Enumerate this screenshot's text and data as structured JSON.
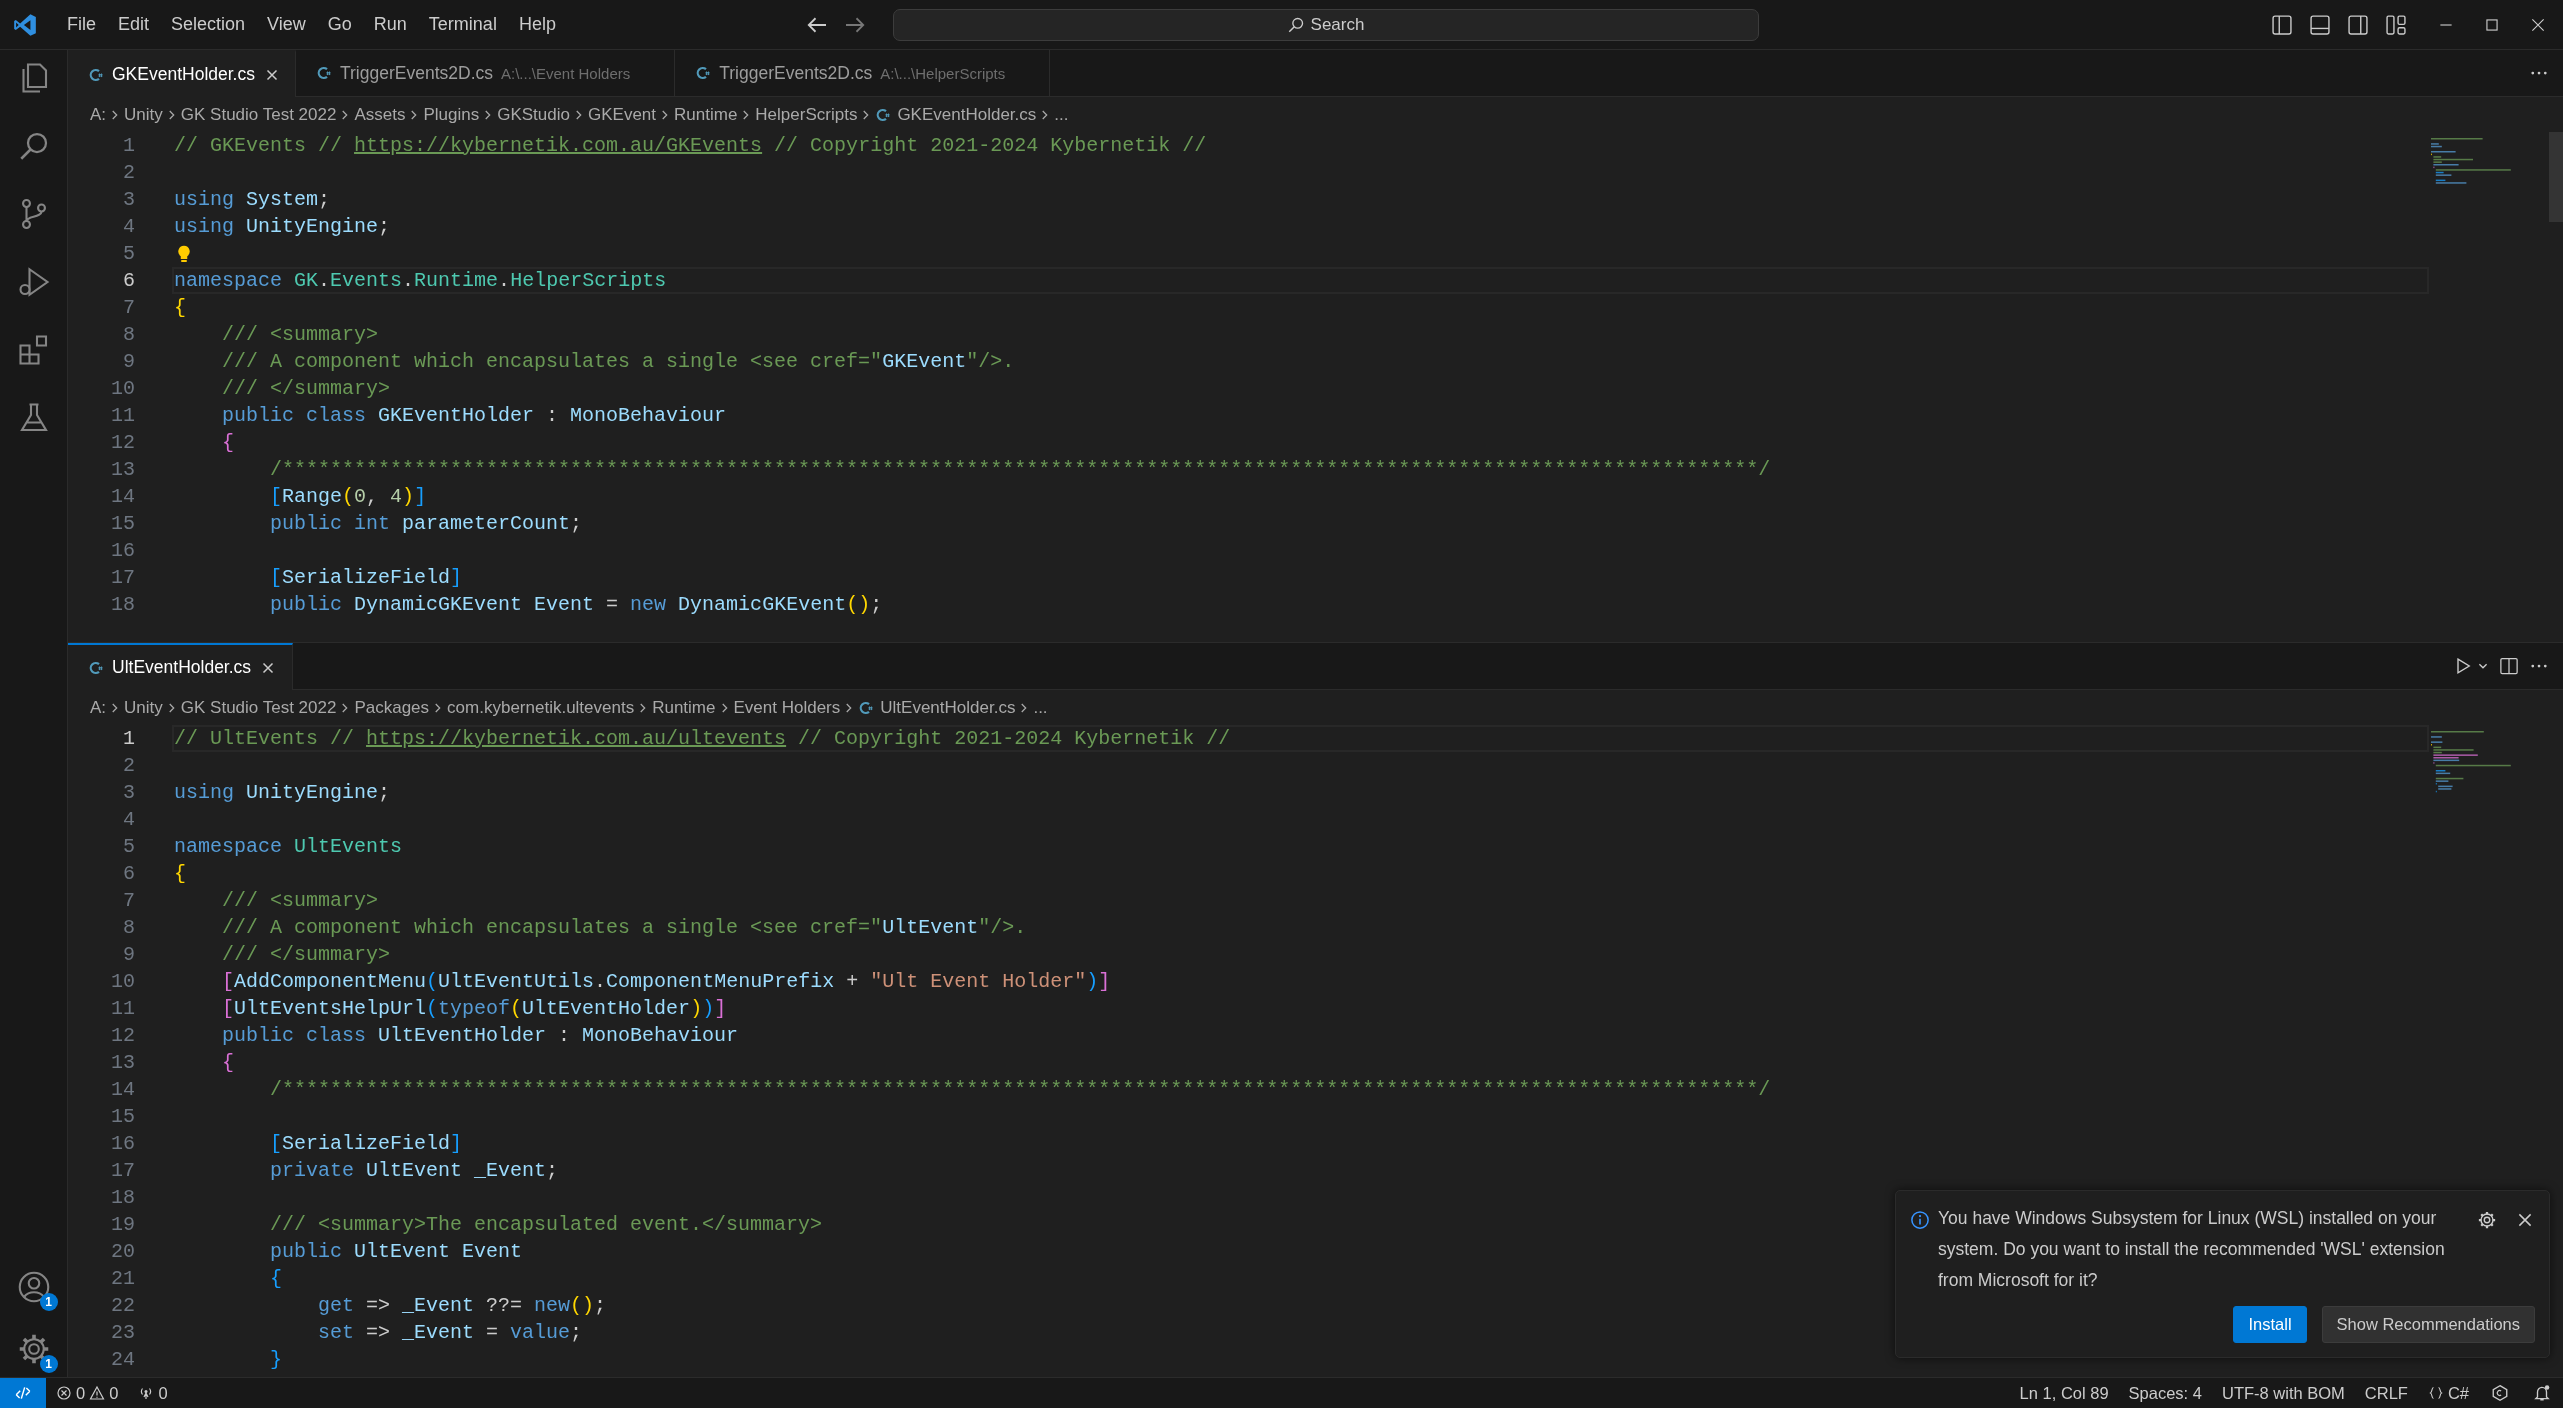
{
  "menu": [
    "File",
    "Edit",
    "Selection",
    "View",
    "Go",
    "Run",
    "Terminal",
    "Help"
  ],
  "search": {
    "placeholder": "Search"
  },
  "activity_badges": {
    "accounts": "1",
    "manage": "1"
  },
  "editors": [
    {
      "tabs": [
        {
          "label": "GKEventHolder.cs",
          "selected": true
        },
        {
          "label": "TriggerEvents2D.cs",
          "description": "A:\\...\\Event Holders",
          "selected": false
        },
        {
          "label": "TriggerEvents2D.cs",
          "description": "A:\\...\\HelperScripts",
          "selected": false
        }
      ],
      "breadcrumbs": [
        {
          "label": "A:",
          "kind": "folder"
        },
        {
          "label": "Unity",
          "kind": "folder"
        },
        {
          "label": "GK Studio Test 2022",
          "kind": "folder"
        },
        {
          "label": "Assets",
          "kind": "folder"
        },
        {
          "label": "Plugins",
          "kind": "folder"
        },
        {
          "label": "GKStudio",
          "kind": "folder"
        },
        {
          "label": "GKEvent",
          "kind": "folder"
        },
        {
          "label": "Runtime",
          "kind": "folder"
        },
        {
          "label": "HelperScripts",
          "kind": "folder"
        },
        {
          "label": "GKEventHolder.cs",
          "kind": "file"
        },
        {
          "label": "...",
          "kind": "more"
        }
      ],
      "lines": [
        {
          "n": "1",
          "current": false,
          "tokens": [
            {
              "kind": "comment",
              "text": "// GKEvents // "
            },
            {
              "kind": "link",
              "text": "https://kybernetik.com.au/GKEvents"
            },
            {
              "kind": "comment",
              "text": " // Copyright 2021-2024 Kybernetik //"
            }
          ]
        },
        {
          "n": "2",
          "current": false
        },
        {
          "n": "3",
          "current": false,
          "tokens": [
            {
              "kind": "keyword",
              "text": "using"
            },
            {
              "kind": "ident",
              "text": " System"
            },
            {
              "kind": "plain",
              "text": ";"
            }
          ]
        },
        {
          "n": "4",
          "current": false,
          "tokens": [
            {
              "kind": "keyword",
              "text": "using"
            },
            {
              "kind": "ident",
              "text": " UnityEngine"
            },
            {
              "kind": "plain",
              "text": ";"
            }
          ]
        },
        {
          "n": "5",
          "current": false,
          "lightbulb": true
        },
        {
          "n": "6",
          "current": true,
          "tokens": [
            {
              "kind": "keyword",
              "text": "namespace"
            },
            {
              "kind": "namespace",
              "text": " GK"
            },
            {
              "kind": "plain",
              "text": "."
            },
            {
              "kind": "namespace",
              "text": "Events"
            },
            {
              "kind": "plain",
              "text": "."
            },
            {
              "kind": "namespace",
              "text": "Runtime"
            },
            {
              "kind": "plain",
              "text": "."
            },
            {
              "kind": "namespace",
              "text": "HelperScripts"
            }
          ]
        },
        {
          "n": "7",
          "current": false,
          "tokens": [
            {
              "kind": "gold",
              "text": "{"
            }
          ]
        },
        {
          "n": "8",
          "current": false,
          "tokens": [
            {
              "kind": "comment",
              "text": "    /// <summary>"
            }
          ]
        },
        {
          "n": "9",
          "current": false,
          "tokens": [
            {
              "kind": "comment",
              "text": "    /// A component which encapsulates a single <see cref=\""
            },
            {
              "kind": "ident",
              "text": "GKEvent"
            },
            {
              "kind": "comment",
              "text": "\"/>."
            }
          ]
        },
        {
          "n": "10",
          "current": false,
          "tokens": [
            {
              "kind": "comment",
              "text": "    /// </summary>"
            }
          ]
        },
        {
          "n": "11",
          "current": false,
          "tokens": [
            {
              "kind": "keyword",
              "text": "    public class"
            },
            {
              "kind": "ident",
              "text": " GKEventHolder"
            },
            {
              "kind": "plain",
              "text": " : "
            },
            {
              "kind": "ident",
              "text": "MonoBehaviour"
            }
          ]
        },
        {
          "n": "12",
          "current": false,
          "tokens": [
            {
              "kind": "pink",
              "text": "    {"
            }
          ]
        },
        {
          "n": "13",
          "current": false,
          "tokens": [
            {
              "kind": "comment",
              "text": "        /***************************************************************************************************************************/"
            }
          ]
        },
        {
          "n": "14",
          "current": false,
          "tokens": [
            {
              "kind": "blue",
              "text": "        ["
            },
            {
              "kind": "ident",
              "text": "Range"
            },
            {
              "kind": "gold",
              "text": "("
            },
            {
              "kind": "number",
              "text": "0"
            },
            {
              "kind": "plain",
              "text": ", "
            },
            {
              "kind": "number",
              "text": "4"
            },
            {
              "kind": "gold",
              "text": ")"
            },
            {
              "kind": "blue",
              "text": "]"
            }
          ]
        },
        {
          "n": "15",
          "current": false,
          "tokens": [
            {
              "kind": "keyword",
              "text": "        public int"
            },
            {
              "kind": "ident",
              "text": " parameterCount"
            },
            {
              "kind": "plain",
              "text": ";"
            }
          ]
        },
        {
          "n": "16",
          "current": false
        },
        {
          "n": "17",
          "current": false,
          "tokens": [
            {
              "kind": "blue",
              "text": "        ["
            },
            {
              "kind": "ident",
              "text": "SerializeField"
            },
            {
              "kind": "blue",
              "text": "]"
            }
          ]
        },
        {
          "n": "18",
          "current": false,
          "tokens": [
            {
              "kind": "keyword",
              "text": "        public"
            },
            {
              "kind": "ident",
              "text": " DynamicGKEvent Event"
            },
            {
              "kind": "plain",
              "text": " = "
            },
            {
              "kind": "keyword",
              "text": "new"
            },
            {
              "kind": "ident",
              "text": " DynamicGKEvent"
            },
            {
              "kind": "gold",
              "text": "()"
            },
            {
              "kind": "plain",
              "text": ";"
            }
          ]
        }
      ]
    },
    {
      "tabs": [
        {
          "label": "UltEventHolder.cs",
          "selected": true
        }
      ],
      "breadcrumbs": [
        {
          "label": "A:",
          "kind": "folder"
        },
        {
          "label": "Unity",
          "kind": "folder"
        },
        {
          "label": "GK Studio Test 2022",
          "kind": "folder"
        },
        {
          "label": "Packages",
          "kind": "folder"
        },
        {
          "label": "com.kybernetik.ultevents",
          "kind": "folder"
        },
        {
          "label": "Runtime",
          "kind": "folder"
        },
        {
          "label": "Event Holders",
          "kind": "folder"
        },
        {
          "label": "UltEventHolder.cs",
          "kind": "file"
        },
        {
          "label": "...",
          "kind": "more"
        }
      ],
      "lines": [
        {
          "n": "1",
          "current": true,
          "tokens": [
            {
              "kind": "comment",
              "text": "// UltEvents // "
            },
            {
              "kind": "link",
              "text": "https://kybernetik.com.au/ultevents"
            },
            {
              "kind": "comment",
              "text": " // Copyright 2021-2024 Kybernetik //"
            }
          ]
        },
        {
          "n": "2",
          "current": false
        },
        {
          "n": "3",
          "current": false,
          "tokens": [
            {
              "kind": "keyword",
              "text": "using"
            },
            {
              "kind": "ident",
              "text": " UnityEngine"
            },
            {
              "kind": "plain",
              "text": ";"
            }
          ]
        },
        {
          "n": "4",
          "current": false
        },
        {
          "n": "5",
          "current": false,
          "tokens": [
            {
              "kind": "keyword",
              "text": "namespace"
            },
            {
              "kind": "namespace",
              "text": " UltEvents"
            }
          ]
        },
        {
          "n": "6",
          "current": false,
          "tokens": [
            {
              "kind": "gold",
              "text": "{"
            }
          ]
        },
        {
          "n": "7",
          "current": false,
          "tokens": [
            {
              "kind": "comment",
              "text": "    /// <summary>"
            }
          ]
        },
        {
          "n": "8",
          "current": false,
          "tokens": [
            {
              "kind": "comment",
              "text": "    /// A component which encapsulates a single <see cref=\""
            },
            {
              "kind": "ident",
              "text": "UltEvent"
            },
            {
              "kind": "comment",
              "text": "\"/>."
            }
          ]
        },
        {
          "n": "9",
          "current": false,
          "tokens": [
            {
              "kind": "comment",
              "text": "    /// </summary>"
            }
          ]
        },
        {
          "n": "10",
          "current": false,
          "tokens": [
            {
              "kind": "pink",
              "text": "    ["
            },
            {
              "kind": "ident",
              "text": "AddComponentMenu"
            },
            {
              "kind": "blue",
              "text": "("
            },
            {
              "kind": "ident",
              "text": "UltEventUtils"
            },
            {
              "kind": "plain",
              "text": "."
            },
            {
              "kind": "ident",
              "text": "ComponentMenuPrefix"
            },
            {
              "kind": "plain",
              "text": " + "
            },
            {
              "kind": "string",
              "text": "\"Ult Event Holder\""
            },
            {
              "kind": "blue",
              "text": ")"
            },
            {
              "kind": "pink",
              "text": "]"
            }
          ]
        },
        {
          "n": "11",
          "current": false,
          "tokens": [
            {
              "kind": "pink",
              "text": "    ["
            },
            {
              "kind": "ident",
              "text": "UltEventsHelpUrl"
            },
            {
              "kind": "blue",
              "text": "("
            },
            {
              "kind": "keyword",
              "text": "typeof"
            },
            {
              "kind": "gold",
              "text": "("
            },
            {
              "kind": "ident",
              "text": "UltEventHolder"
            },
            {
              "kind": "gold",
              "text": ")"
            },
            {
              "kind": "blue",
              "text": ")"
            },
            {
              "kind": "pink",
              "text": "]"
            }
          ]
        },
        {
          "n": "12",
          "current": false,
          "tokens": [
            {
              "kind": "keyword",
              "text": "    public class"
            },
            {
              "kind": "ident",
              "text": " UltEventHolder"
            },
            {
              "kind": "plain",
              "text": " : "
            },
            {
              "kind": "ident",
              "text": "MonoBehaviour"
            }
          ]
        },
        {
          "n": "13",
          "current": false,
          "tokens": [
            {
              "kind": "pink",
              "text": "    {"
            }
          ]
        },
        {
          "n": "14",
          "current": false,
          "tokens": [
            {
              "kind": "comment",
              "text": "        /***************************************************************************************************************************/"
            }
          ]
        },
        {
          "n": "15",
          "current": false
        },
        {
          "n": "16",
          "current": false,
          "tokens": [
            {
              "kind": "blue",
              "text": "        ["
            },
            {
              "kind": "ident",
              "text": "SerializeField"
            },
            {
              "kind": "blue",
              "text": "]"
            }
          ]
        },
        {
          "n": "17",
          "current": false,
          "tokens": [
            {
              "kind": "keyword",
              "text": "        private"
            },
            {
              "kind": "ident",
              "text": " UltEvent _Event"
            },
            {
              "kind": "plain",
              "text": ";"
            }
          ]
        },
        {
          "n": "18",
          "current": false
        },
        {
          "n": "19",
          "current": false,
          "tokens": [
            {
              "kind": "comment",
              "text": "        /// <summary>The encapsulated event.</summary>"
            }
          ]
        },
        {
          "n": "20",
          "current": false,
          "tokens": [
            {
              "kind": "keyword",
              "text": "        public"
            },
            {
              "kind": "ident",
              "text": " UltEvent Event"
            }
          ]
        },
        {
          "n": "21",
          "current": false,
          "tokens": [
            {
              "kind": "blue",
              "text": "        {"
            }
          ]
        },
        {
          "n": "22",
          "current": false,
          "tokens": [
            {
              "kind": "keyword",
              "text": "            get"
            },
            {
              "kind": "plain",
              "text": " => "
            },
            {
              "kind": "ident",
              "text": "_Event"
            },
            {
              "kind": "plain",
              "text": " ??= "
            },
            {
              "kind": "keyword",
              "text": "new"
            },
            {
              "kind": "gold",
              "text": "()"
            },
            {
              "kind": "plain",
              "text": ";"
            }
          ]
        },
        {
          "n": "23",
          "current": false,
          "tokens": [
            {
              "kind": "keyword",
              "text": "            set"
            },
            {
              "kind": "plain",
              "text": " => "
            },
            {
              "kind": "ident",
              "text": "_Event"
            },
            {
              "kind": "plain",
              "text": " = "
            },
            {
              "kind": "keyword",
              "text": "value"
            },
            {
              "kind": "plain",
              "text": ";"
            }
          ]
        },
        {
          "n": "24",
          "current": false,
          "tokens": [
            {
              "kind": "blue",
              "text": "        }"
            }
          ]
        }
      ]
    }
  ],
  "notification": {
    "message": "You have Windows Subsystem for Linux (WSL) installed on your system. Do you want to install the recommended 'WSL' extension from Microsoft for it?",
    "buttons": [
      {
        "label": "Install",
        "primary": true
      },
      {
        "label": "Show Recommendations",
        "primary": false
      }
    ]
  },
  "status_bar": {
    "errors": "0",
    "warnings": "0",
    "ports": "0",
    "items": [
      "Ln 1, Col 89",
      "Spaces: 4",
      "UTF-8 with BOM",
      "CRLF"
    ],
    "language": "C#"
  }
}
